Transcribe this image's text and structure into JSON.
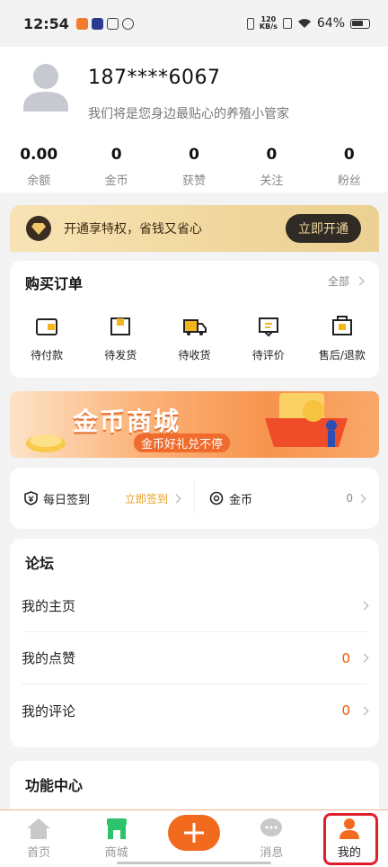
{
  "status_bar": {
    "time": "12:54",
    "net_speed_value": "120",
    "net_speed_unit": "KB/s",
    "battery": "64%"
  },
  "profile": {
    "phone": "187****6067",
    "slogan": "我们将是您身边最贴心的养殖小管家",
    "stats": [
      {
        "value": "0.00",
        "label": "余额"
      },
      {
        "value": "0",
        "label": "金币"
      },
      {
        "value": "0",
        "label": "获赞"
      },
      {
        "value": "0",
        "label": "关注"
      },
      {
        "value": "0",
        "label": "粉丝"
      }
    ]
  },
  "vip": {
    "text": "开通享特权，省钱又省心",
    "button": "立即开通"
  },
  "orders": {
    "title": "购买订单",
    "all_label": "全部",
    "items": [
      {
        "label": "待付款",
        "icon": "wallet-icon"
      },
      {
        "label": "待发货",
        "icon": "box-icon"
      },
      {
        "label": "待收货",
        "icon": "truck-icon"
      },
      {
        "label": "待评价",
        "icon": "comment-icon"
      },
      {
        "label": "售后/退款",
        "icon": "refund-icon"
      }
    ]
  },
  "mall_banner": {
    "title": "金币商城",
    "subtitle": "金币好礼兑不停"
  },
  "checkin": {
    "daily_label": "每日签到",
    "daily_action": "立即签到",
    "coin_label": "金币",
    "coin_value": "0"
  },
  "forum": {
    "title": "论坛",
    "rows": [
      {
        "label": "我的主页",
        "count": ""
      },
      {
        "label": "我的点赞",
        "count": "0"
      },
      {
        "label": "我的评论",
        "count": "0"
      }
    ]
  },
  "function_center": {
    "title": "功能中心"
  },
  "tabbar": {
    "home": "首页",
    "mall": "商城",
    "messages": "消息",
    "mine": "我的"
  },
  "colors": {
    "accent": "#f26a1d",
    "vip_dark": "#2f2a24",
    "gold": "#e7a229",
    "highlight": "#e01e2b"
  }
}
